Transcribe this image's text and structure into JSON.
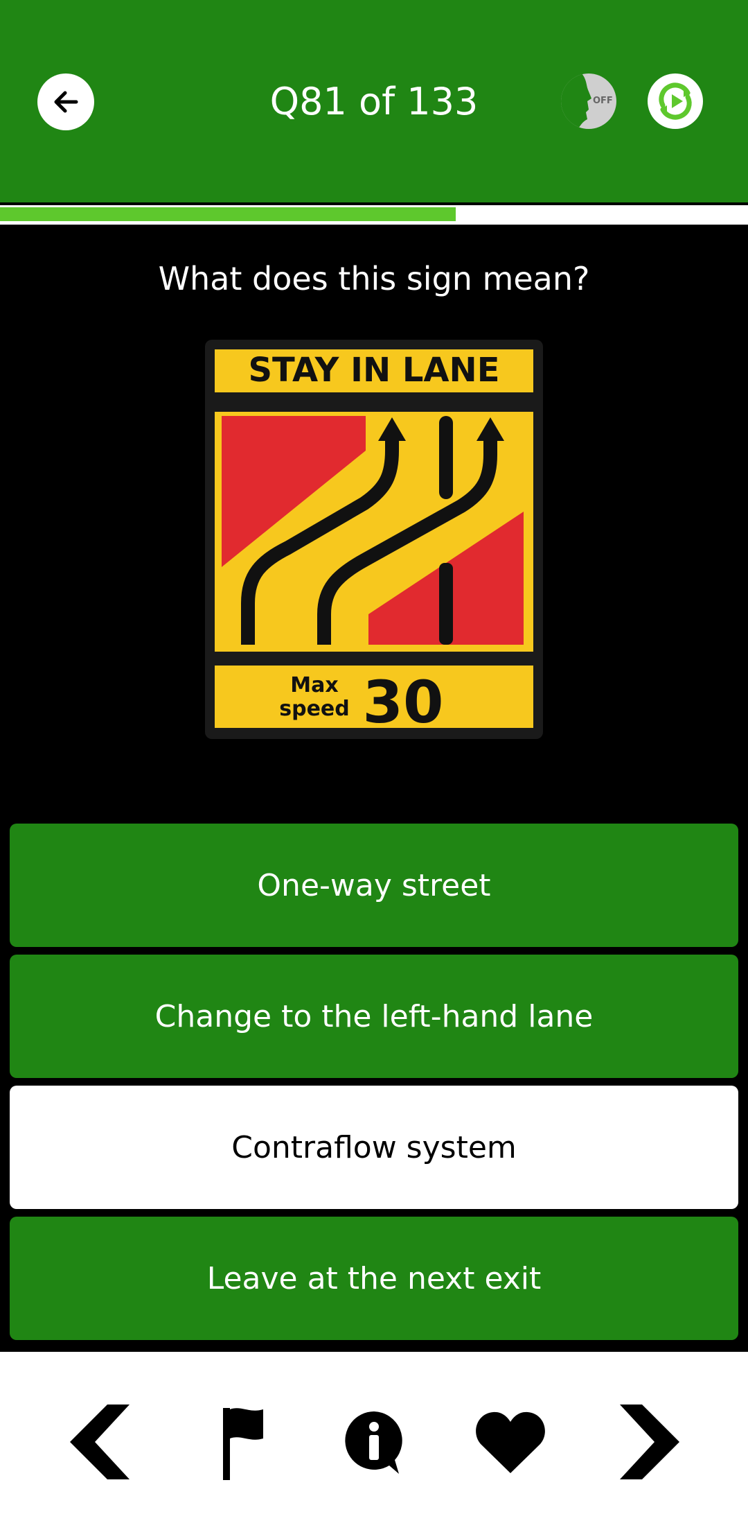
{
  "header": {
    "title": "Q81 of 133",
    "voice_toggle_label": "OFF",
    "icons": [
      "back-arrow-icon",
      "voice-off-icon",
      "refresh-play-icon"
    ]
  },
  "progress": {
    "current": 81,
    "total": 133,
    "fraction": 0.609
  },
  "question": {
    "text": "What does this sign mean?",
    "sign": {
      "top_text": "STAY IN LANE",
      "speed_label_line1": "Max",
      "speed_label_line2": "speed",
      "speed_value": "30"
    }
  },
  "answers": [
    {
      "label": "One-way street",
      "selected": false
    },
    {
      "label": "Change to the left-hand lane",
      "selected": false
    },
    {
      "label": "Contraflow system",
      "selected": true
    },
    {
      "label": "Leave at the next exit",
      "selected": false
    }
  ],
  "bottom_nav": {
    "icons": [
      "previous-chevron-icon",
      "flag-icon",
      "info-icon",
      "heart-icon",
      "next-chevron-icon"
    ]
  },
  "colors": {
    "header_green": "#208614",
    "progress_green": "#5ec82d",
    "answer_green": "#208614",
    "sign_yellow": "#f7c81e",
    "sign_red": "#e12a2f"
  }
}
